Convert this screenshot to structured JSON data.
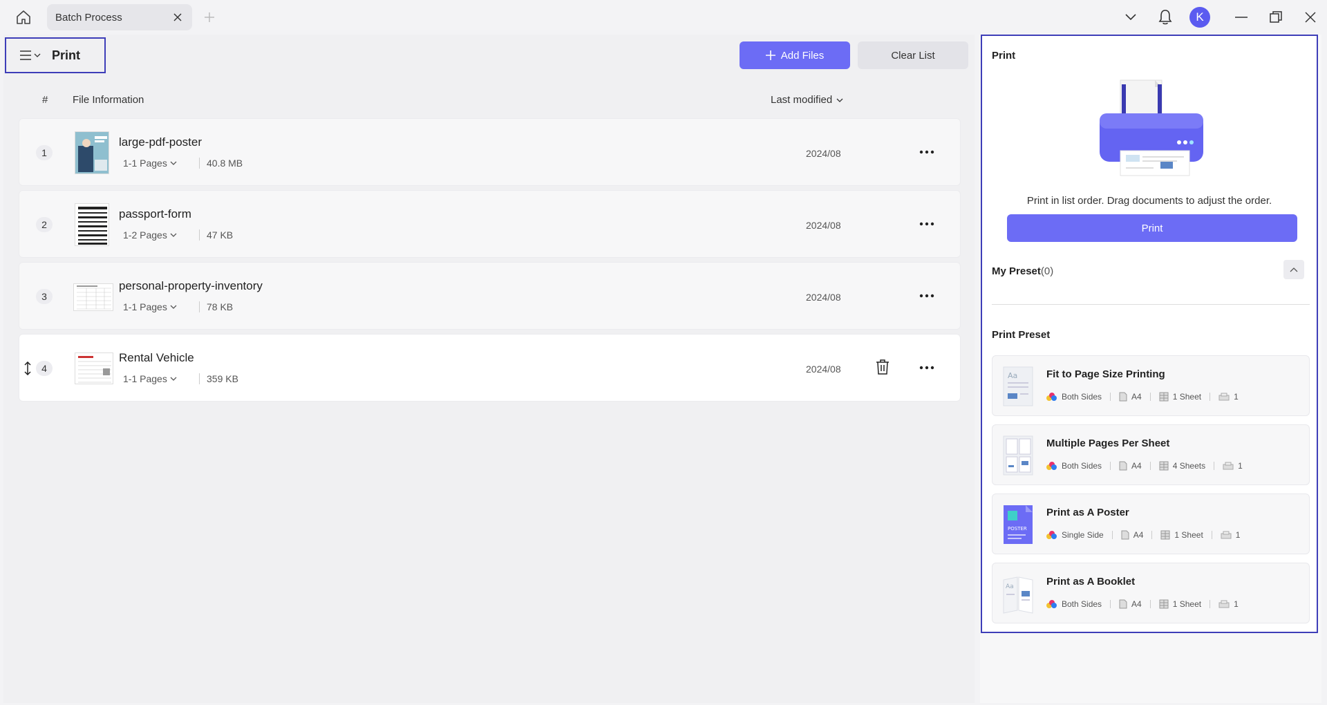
{
  "titlebar": {
    "tab_label": "Batch Process",
    "avatar_letter": "K"
  },
  "header": {
    "title": "Print",
    "add_files_label": "Add Files",
    "clear_list_label": "Clear List"
  },
  "table": {
    "col_index": "#",
    "col_info": "File Information",
    "col_sort": "Last modified"
  },
  "files": [
    {
      "index": "1",
      "name": "large-pdf-poster",
      "pages": "1-1 Pages",
      "size": "40.8 MB",
      "date": "2024/08"
    },
    {
      "index": "2",
      "name": "passport-form",
      "pages": "1-2 Pages",
      "size": "47 KB",
      "date": "2024/08"
    },
    {
      "index": "3",
      "name": "personal-property-inventory",
      "pages": "1-1 Pages",
      "size": "78 KB",
      "date": "2024/08"
    },
    {
      "index": "4",
      "name": "Rental Vehicle",
      "pages": "1-1 Pages",
      "size": "359 KB",
      "date": "2024/08"
    }
  ],
  "panel": {
    "title": "Print",
    "hint": "Print in list order. Drag documents to adjust the order.",
    "print_button": "Print",
    "my_preset_label": "My Preset",
    "my_preset_count": "(0)",
    "print_preset_label": "Print Preset",
    "presets": [
      {
        "name": "Fit to Page Size Printing",
        "sides": "Both Sides",
        "paper": "A4",
        "sheets": "1 Sheet",
        "copies": "1"
      },
      {
        "name": "Multiple Pages Per Sheet",
        "sides": "Both Sides",
        "paper": "A4",
        "sheets": "4 Sheets",
        "copies": "1"
      },
      {
        "name": "Print as A Poster",
        "sides": "Single Side",
        "paper": "A4",
        "sheets": "1 Sheet",
        "copies": "1"
      },
      {
        "name": "Print as A Booklet",
        "sides": "Both Sides",
        "paper": "A4",
        "sheets": "1 Sheet",
        "copies": "1"
      }
    ]
  },
  "colors": {
    "accent": "#6c6cf5",
    "highlight_border": "#3d3db8"
  },
  "icons": [
    "home-icon",
    "close-icon",
    "plus-icon",
    "chevron-down-icon",
    "bell-icon",
    "minimize-icon",
    "restore-icon",
    "menu-icon",
    "more-icon",
    "trash-icon",
    "drag-icon",
    "chevron-up-icon",
    "printer-illustration",
    "sides-icon",
    "paper-icon",
    "sheets-icon",
    "copies-icon"
  ]
}
